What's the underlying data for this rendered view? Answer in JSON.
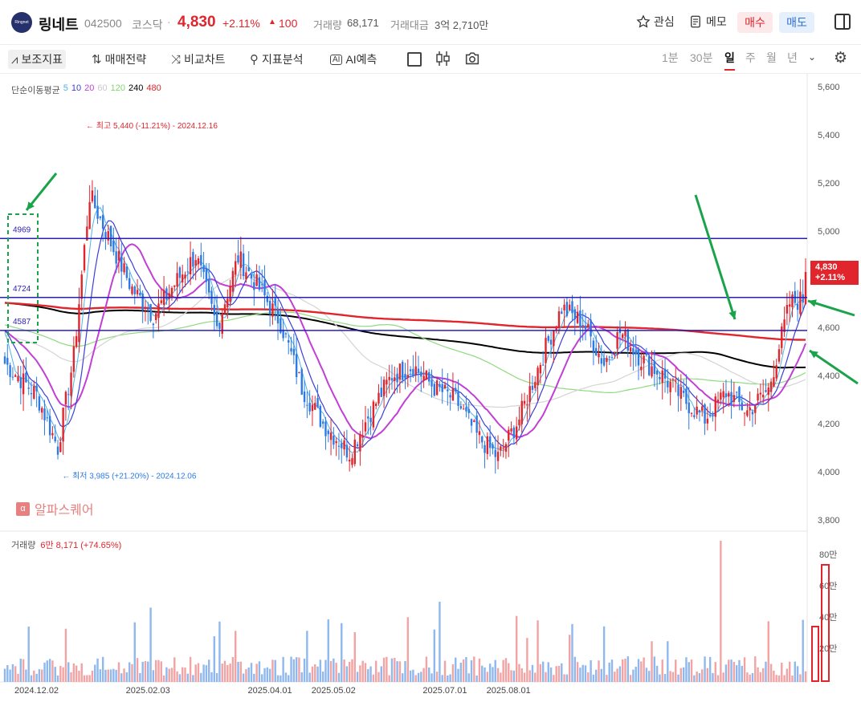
{
  "header": {
    "logo_text": "Ringnet",
    "name": "링네트",
    "code": "042500",
    "market": "코스닥",
    "separator": "·",
    "price": "4,830",
    "change_pct": "+2.11%",
    "change_arrow": "▲",
    "change_val": "100",
    "volume_label": "거래량",
    "volume_value": "68,171",
    "amount_label": "거래대금",
    "amount_value": "3억 2,710만",
    "watch_label": "관심",
    "memo_label": "메모",
    "buy_label": "매수",
    "sell_label": "매도"
  },
  "toolbar": {
    "items": [
      "보조지표",
      "매매전략",
      "비교차트",
      "지표분석",
      "AI예측"
    ],
    "periods": [
      "1분",
      "30분",
      "일",
      "주",
      "월",
      "년"
    ],
    "active_period": "일"
  },
  "legend": {
    "title": "단순이동평균",
    "periods": [
      "5",
      "10",
      "20",
      "60",
      "120",
      "240",
      "480"
    ],
    "colors": [
      "#4fb3e6",
      "#3b3fd8",
      "#c23fd6",
      "#c9c9c9",
      "#7fd66f",
      "#000000",
      "#e0252c"
    ]
  },
  "volume_legend": {
    "label": "거래량",
    "value": "6만 8,171 (+74.65%)"
  },
  "watermark": {
    "icon": "α",
    "text": "알파스퀘어"
  },
  "last_badge": {
    "price": "4,830",
    "pct": "+2.11%"
  },
  "colors": {
    "up": "#e0252c",
    "down": "#2c7be5",
    "vol_up": "#f2a3a3",
    "vol_down": "#8fb8ee",
    "hline": "#2a1fb5",
    "annotation": "#1aa34a"
  },
  "chart_data": {
    "type": "candlestick",
    "y_axis": {
      "range": [
        3800,
        5600
      ],
      "ticks": [
        "5,600",
        "5,400",
        "5,200",
        "5,000",
        "4,800",
        "4,600",
        "4,400",
        "4,200",
        "4,000",
        "3,800"
      ]
    },
    "volume_axis": {
      "ticks": [
        "80만",
        "60만",
        "40만",
        "20만"
      ]
    },
    "x_labels": [
      "2024.12.02",
      "2025.02.03",
      "2025.04.01",
      "2025.05.02",
      "2025.07.01",
      "2025.08.01"
    ],
    "horizontal_lines": [
      {
        "label": "4969",
        "value": 4969
      },
      {
        "label": "4724",
        "value": 4724
      },
      {
        "label": "4587",
        "value": 4587
      }
    ],
    "high_annotation": "최고 5,440 (-11.21%) - 2024.12.16",
    "low_annotation": "최저 3,985 (+21.20%) - 2024.12.06",
    "last_price": 4830,
    "anchors": [
      [
        0,
        4450
      ],
      [
        12,
        4320
      ],
      [
        20,
        4100
      ],
      [
        26,
        4480
      ],
      [
        32,
        5150
      ],
      [
        40,
        4950
      ],
      [
        48,
        4760
      ],
      [
        56,
        4650
      ],
      [
        64,
        4780
      ],
      [
        72,
        4900
      ],
      [
        80,
        4600
      ],
      [
        88,
        4890
      ],
      [
        96,
        4760
      ],
      [
        104,
        4620
      ],
      [
        112,
        4350
      ],
      [
        120,
        4200
      ],
      [
        130,
        4080
      ],
      [
        138,
        4250
      ],
      [
        146,
        4400
      ],
      [
        154,
        4440
      ],
      [
        162,
        4350
      ],
      [
        170,
        4300
      ],
      [
        178,
        4150
      ],
      [
        186,
        4060
      ],
      [
        194,
        4220
      ],
      [
        202,
        4460
      ],
      [
        210,
        4680
      ],
      [
        218,
        4620
      ],
      [
        226,
        4450
      ],
      [
        232,
        4580
      ],
      [
        240,
        4470
      ],
      [
        248,
        4400
      ],
      [
        256,
        4300
      ],
      [
        264,
        4220
      ],
      [
        272,
        4330
      ],
      [
        280,
        4250
      ],
      [
        288,
        4340
      ],
      [
        296,
        4700
      ],
      [
        302,
        4720
      ]
    ],
    "volume_spike_index": 270
  }
}
